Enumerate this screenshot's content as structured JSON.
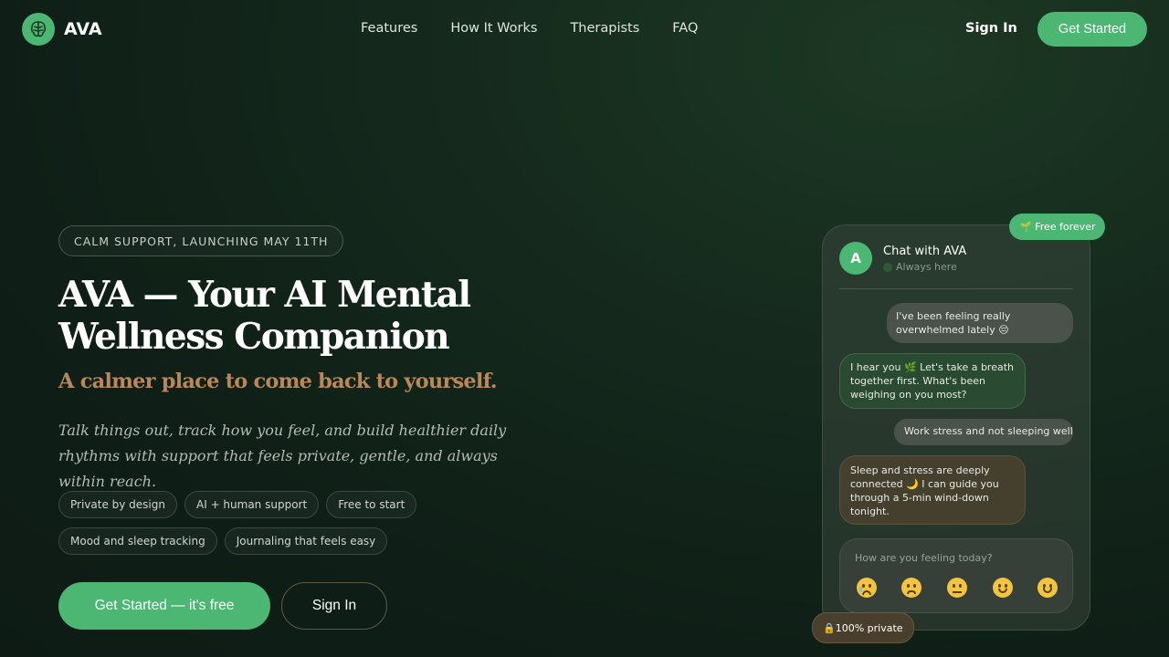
{
  "brand": {
    "name": "AVA",
    "logo_icon": "brain-icon",
    "accent": "#4cb673"
  },
  "nav": {
    "links": [
      "Features",
      "How It Works",
      "Therapists",
      "FAQ"
    ],
    "signin": "Sign In",
    "cta": "Get Started"
  },
  "hero": {
    "tagline": "CALM SUPPORT, LAUNCHING MAY 11TH",
    "headline": "AVA — Your AI Mental Wellness Companion",
    "subhead": "A calmer place to come back to yourself.",
    "intro": "Talk things out, track how you feel, and build healthier daily rhythms with support that feels private, gentle, and always within reach.",
    "chips": [
      "Private by design",
      "AI + human support",
      "Free to start",
      "Mood and sleep tracking",
      "Journaling that feels easy"
    ],
    "cta_primary": "Get Started — it's free",
    "cta_secondary": "Sign In"
  },
  "chat": {
    "badge": "🌱 Free forever",
    "avatar_letter": "A",
    "title": "Chat with AVA",
    "status": "Always here",
    "messages": [
      "I've been feeling really overwhelmed lately 😔",
      "I hear you 🌿 Let's take a breath together first. What's been weighing on you most?",
      "Work stress and not sleeping well",
      "Sleep and stress are deeply connected 🌙 I can guide you through a 5-min wind-down tonight."
    ],
    "mood_question": "How are you feeling today?",
    "moods": [
      "crying-face-icon",
      "worried-face-icon",
      "neutral-face-icon",
      "slightly-smiling-face-icon",
      "smiling-face-icon"
    ],
    "private_badge": "🔒100% private"
  }
}
